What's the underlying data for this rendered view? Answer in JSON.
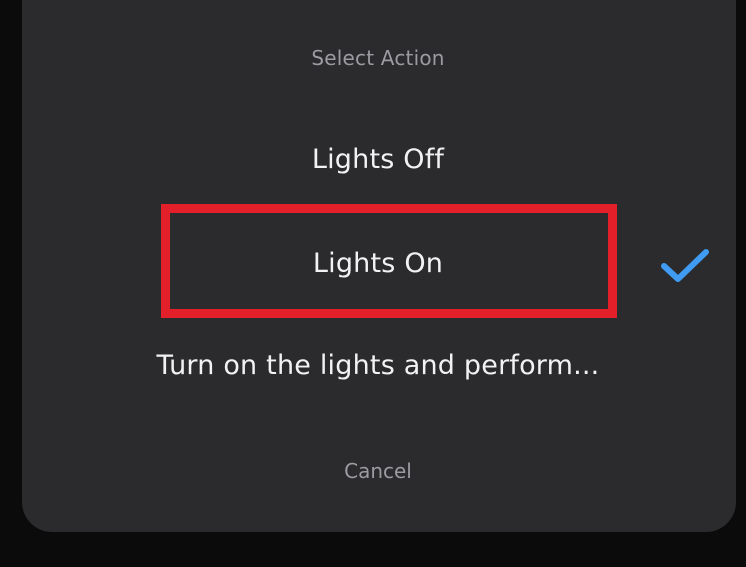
{
  "sheet": {
    "title": "Select Action",
    "options": [
      {
        "label": "Lights Off",
        "selected": false
      },
      {
        "label": "Lights On",
        "selected": true
      },
      {
        "label": "Turn on the lights and perform...",
        "selected": false
      }
    ],
    "cancel_label": "Cancel"
  },
  "icons": {
    "selected_indicator": "checkmark-icon"
  },
  "colors": {
    "sheet_background": "#2b2b2d",
    "primary_text": "#f2f2f4",
    "secondary_text": "#9b9ba0",
    "checkmark": "#3f9cf2",
    "highlight_box": "#e3202a"
  }
}
